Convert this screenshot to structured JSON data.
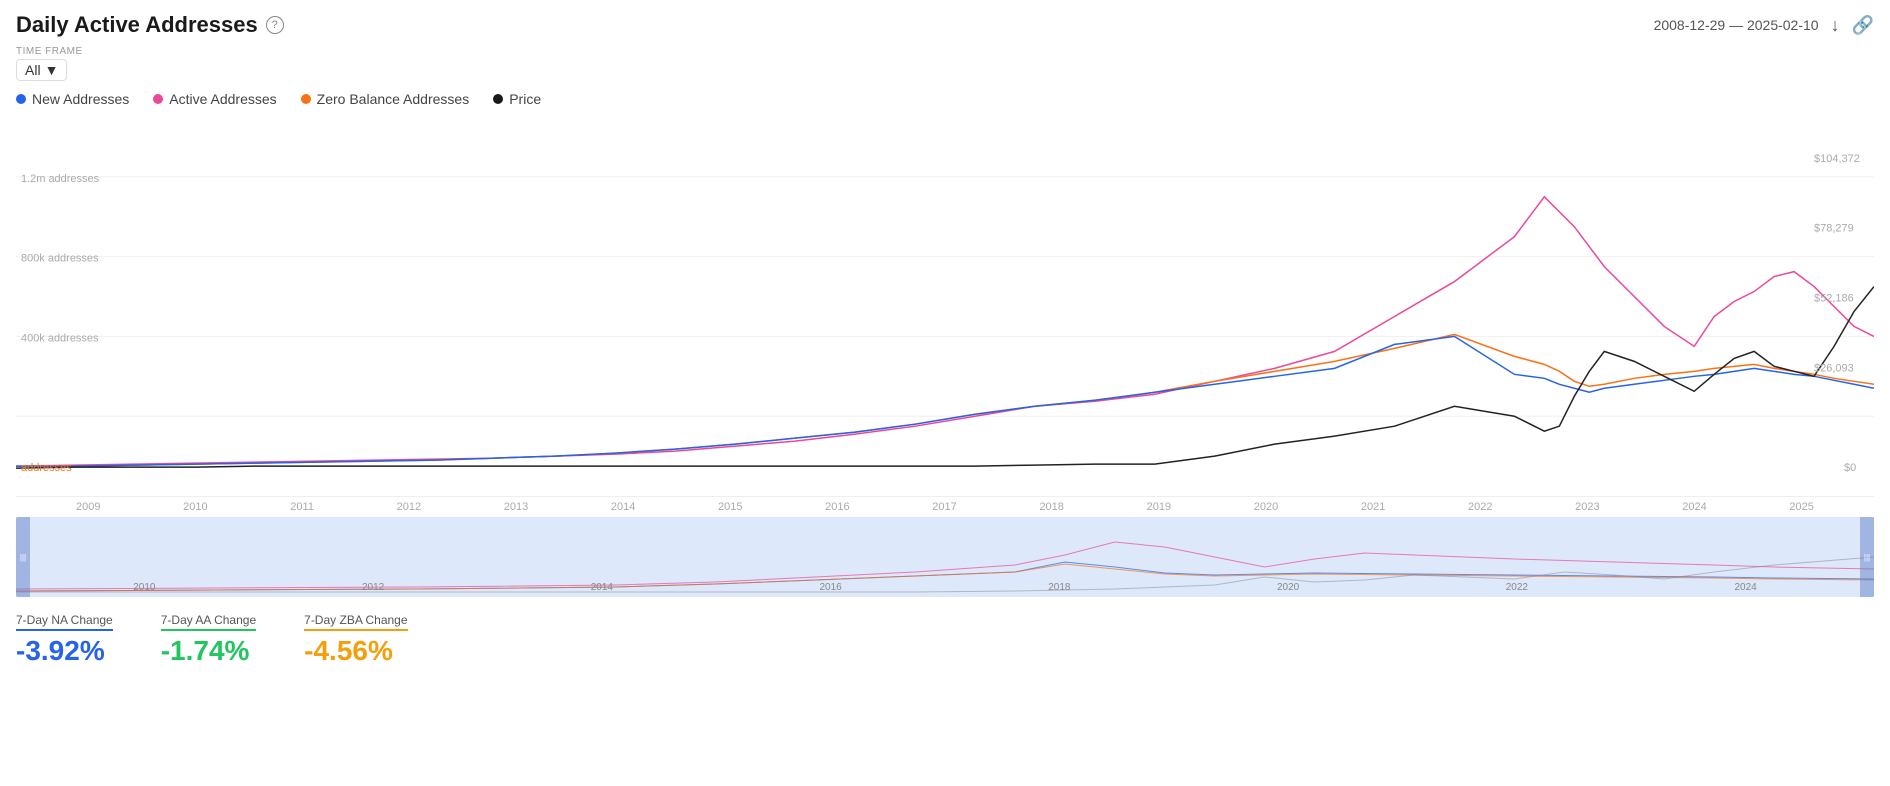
{
  "header": {
    "title": "Daily Active Addresses",
    "info_icon": "ⓘ",
    "date_range": "2008-12-29 — 2025-02-10",
    "download_icon": "⬇",
    "link_icon": "🔗"
  },
  "timeframe": {
    "label": "TIME FRAME",
    "value": "All"
  },
  "legend": {
    "items": [
      {
        "label": "New Addresses",
        "color": "#2563eb"
      },
      {
        "label": "Active Addresses",
        "color": "#ec4899"
      },
      {
        "label": "Zero Balance Addresses",
        "color": "#f97316"
      },
      {
        "label": "Price",
        "color": "#1a1a1a"
      }
    ]
  },
  "y_axis_left": {
    "labels": [
      "1.2m addresses",
      "800k addresses",
      "400k addresses",
      "addresses"
    ]
  },
  "y_axis_right": {
    "labels": [
      "$104,372",
      "$78,279",
      "$52,186",
      "$26,093",
      "$0"
    ]
  },
  "x_axis": {
    "labels": [
      "2009",
      "2010",
      "2011",
      "2012",
      "2013",
      "2014",
      "2015",
      "2016",
      "2017",
      "2018",
      "2019",
      "2020",
      "2021",
      "2022",
      "2023",
      "2024",
      "2025"
    ]
  },
  "navigator": {
    "labels": [
      "2010",
      "2012",
      "2014",
      "2016",
      "2018",
      "2020",
      "2022",
      "2024"
    ]
  },
  "stats": [
    {
      "label": "7-Day NA Change",
      "value": "-3.92%",
      "class": "stat-na"
    },
    {
      "label": "7-Day AA Change",
      "value": "-1.74%",
      "class": "stat-aa"
    },
    {
      "label": "7-Day ZBA Change",
      "value": "-4.56%",
      "class": "stat-zba"
    }
  ]
}
